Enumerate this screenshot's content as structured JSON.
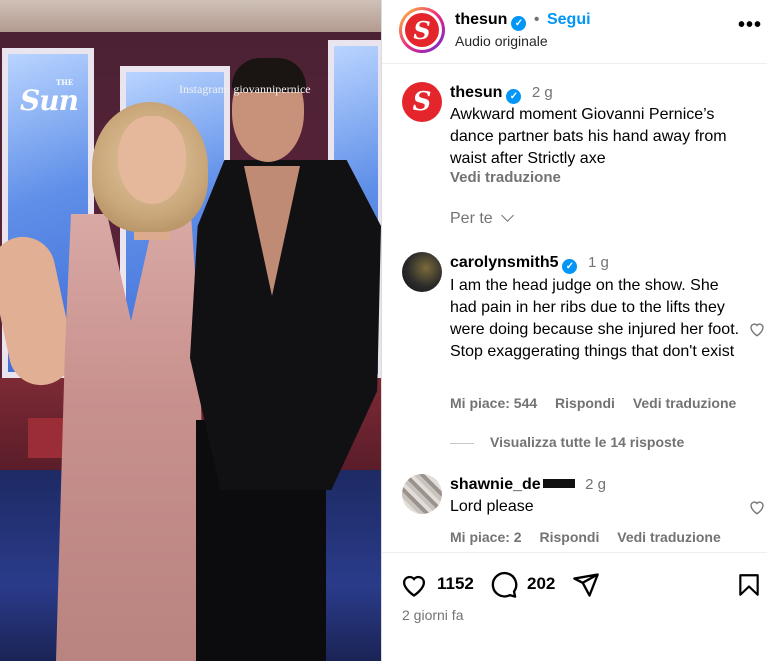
{
  "media": {
    "brand_logo": "Sun",
    "brand_logo_small": "THE",
    "watermark": "Instagram: giovannipernice"
  },
  "post": {
    "username": "thesun",
    "follow_label": "Segui",
    "audio": "Audio originale",
    "more": "•••",
    "caption": {
      "username": "thesun",
      "time": "2 g",
      "text": "Awkward moment Giovanni Pernice’s dance partner bats his hand away from waist after Strictly axe",
      "translate": "Vedi traduzione"
    },
    "sort_label": "Per te",
    "comments": [
      {
        "username": "carolynsmith5",
        "time": "1 g",
        "text": "I am the head judge on the show. She had pain in her ribs due to the lifts they were doing because she injured her foot. Stop exaggerating things that don't exist",
        "likes": "Mi piace: 544",
        "reply": "Rispondi",
        "translate": "Vedi traduzione",
        "view_replies": "Visualizza tutte le 14 risposte"
      },
      {
        "username": "shawnie_de",
        "time": "2 g",
        "text": "Lord please",
        "likes": "Mi piace: 2",
        "reply": "Rispondi",
        "translate": "Vedi traduzione"
      }
    ],
    "like_count": "1152",
    "comment_count": "202",
    "date": "2 giorni fa"
  },
  "colors": {
    "accent": "#0095f6",
    "brand": "#e4262c",
    "muted": "#737373"
  }
}
